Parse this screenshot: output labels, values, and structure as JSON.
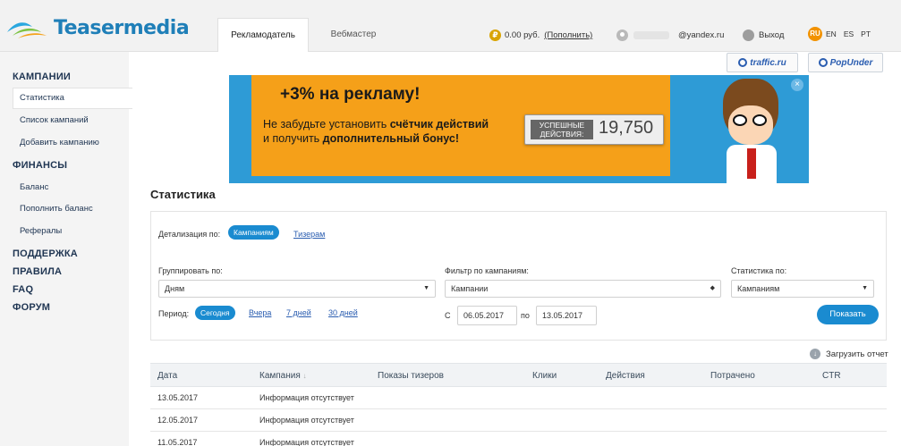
{
  "brand": {
    "name": "Teasermedia"
  },
  "tabs": [
    {
      "label": "Рекламодатель",
      "active": true
    },
    {
      "label": "Вебмастер",
      "active": false
    }
  ],
  "account": {
    "balance": "0.00 руб.",
    "topup_link": "(Пополнить)",
    "email_suffix": "@yandex.ru",
    "logout": "Выход",
    "coin_symbol": "₽"
  },
  "languages": [
    "RU",
    "EN",
    "ES",
    "PT"
  ],
  "sidebar": {
    "sections": [
      {
        "title": "КАМПАНИИ",
        "items": [
          "Статистика",
          "Список кампаний",
          "Добавить кампанию"
        ]
      },
      {
        "title": "ФИНАНСЫ",
        "items": [
          "Баланс",
          "Пополнить баланс",
          "Рефералы"
        ]
      }
    ],
    "links": [
      "ПОДДЕРЖКА",
      "ПРАВИЛА",
      "FAQ",
      "ФОРУМ"
    ]
  },
  "partners": {
    "traffic": "traffic.ru",
    "popunder": "PopUnder"
  },
  "banner": {
    "title": "+3% на рекламу!",
    "line1_a": "Не забудьте установить ",
    "line1_b": "счётчик действий",
    "line2_a": "и получить ",
    "line2_b": "дополнительный бонус!",
    "counter_label": "УСПЕШНЫЕ ДЕЙСТВИЯ:",
    "counter_value": "19,7",
    "counter_digits": "50",
    "close": "×"
  },
  "page": {
    "title": "Статистика"
  },
  "filters": {
    "detail_label": "Детализация по:",
    "detail_options": [
      "Кампаниям",
      "Тизерам"
    ],
    "group_label": "Группировать по:",
    "group_value": "Дням",
    "campaign_filter_label": "Фильтр по кампаниям:",
    "campaign_filter_value": "Кампании",
    "stats_by_label": "Статистика по:",
    "stats_by_value": "Кампаниям",
    "period_label": "Период:",
    "period_options": [
      "Сегодня",
      "Вчера",
      "7 дней",
      "30 дней"
    ],
    "from_label": "С",
    "from_date": "06.05.2017",
    "to_label": "по",
    "to_date": "13.05.2017",
    "show_button": "Показать"
  },
  "download": {
    "label": "Загрузить отчет"
  },
  "table": {
    "columns": [
      "Дата",
      "Кампания",
      "Показы тизеров",
      "Клики",
      "Действия",
      "Потрачено",
      "CTR"
    ],
    "sort_marker": "↓",
    "rows": [
      [
        "13.05.2017",
        "Информация отсутствует"
      ],
      [
        "12.05.2017",
        "Информация отсутствует"
      ],
      [
        "11.05.2017",
        "Информация отсутствует"
      ]
    ]
  },
  "colors": {
    "accent": "#1a8bd0",
    "banner_orange": "#f5a019",
    "banner_blue": "#2e9bd6",
    "lang_active": "#f29200"
  }
}
